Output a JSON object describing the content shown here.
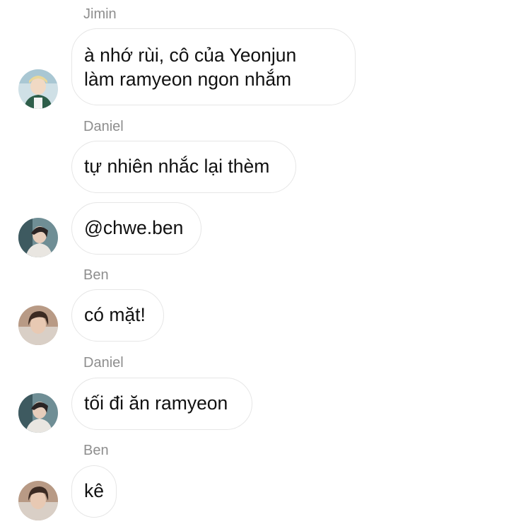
{
  "messages": [
    {
      "sender": "Jimin",
      "lines": [
        "à nhớ rùi, cô của Yeonjun",
        "làm ramyeon ngon nhắm"
      ],
      "avatar": "jimin-avatar"
    },
    {
      "sender": "Daniel",
      "lines": [
        "tự nhiên nhắc lại thèm"
      ]
    },
    {
      "lines": [
        "@chwe.ben"
      ],
      "avatar": "daniel-avatar"
    },
    {
      "sender": "Ben",
      "lines": [
        "có mặt!"
      ],
      "avatar": "ben-avatar"
    },
    {
      "sender": "Daniel",
      "lines": [
        "tối đi ăn ramyeon"
      ],
      "avatar": "daniel-avatar"
    },
    {
      "sender": "Ben",
      "lines": [
        "kê"
      ],
      "avatar": "ben-avatar"
    }
  ],
  "colors": {
    "sender_name": "#8e8e8e",
    "bubble_border": "#e6e6e6",
    "text": "#111111",
    "background": "#ffffff"
  }
}
